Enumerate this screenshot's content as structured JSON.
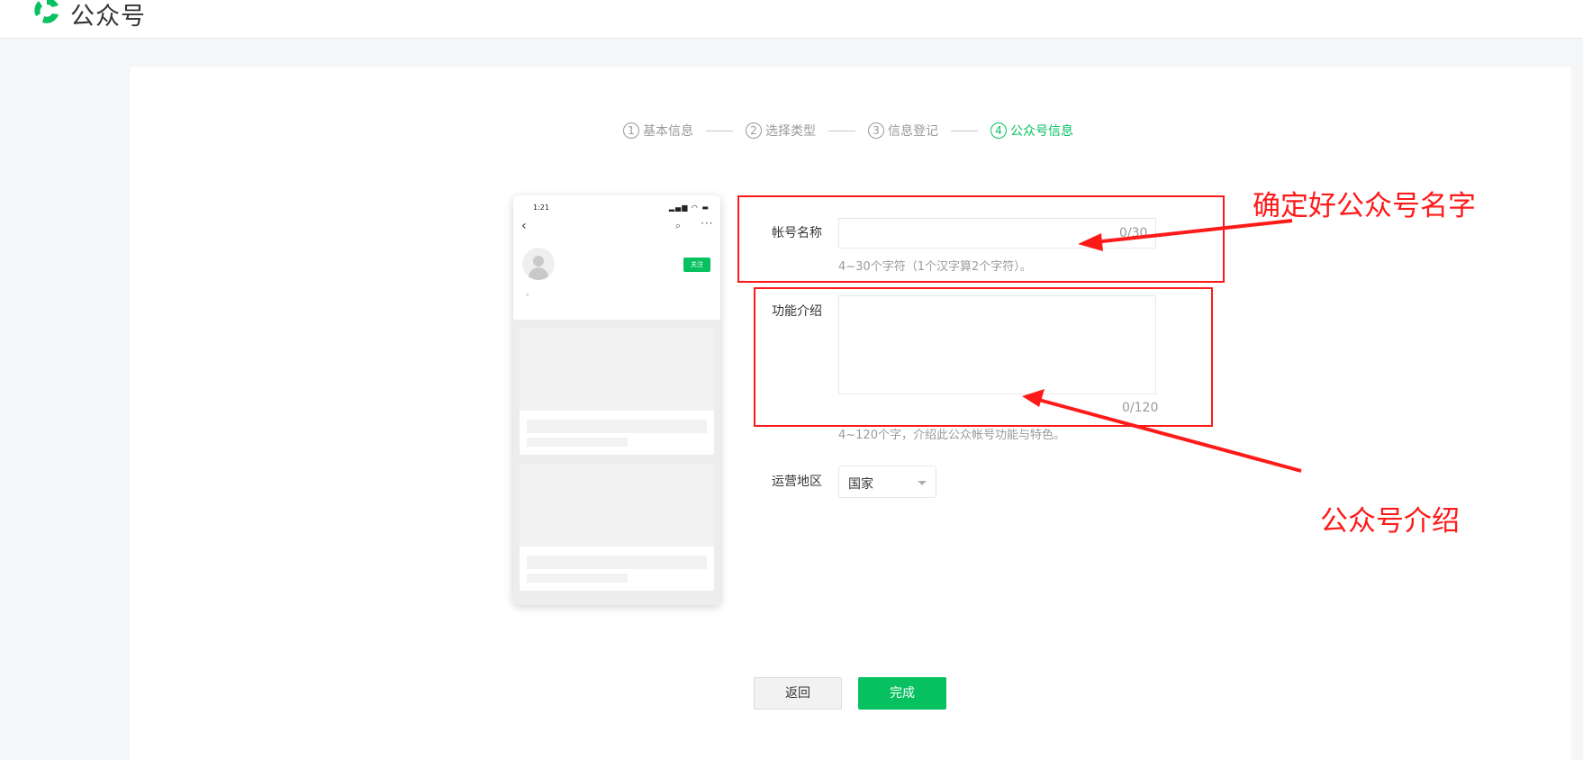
{
  "header": {
    "brand": "公众号",
    "logo_icon": "wechat-official-account-logo-icon"
  },
  "steps": [
    {
      "num": "1",
      "label": "基本信息",
      "active": false
    },
    {
      "num": "2",
      "label": "选择类型",
      "active": false
    },
    {
      "num": "3",
      "label": "信息登记",
      "active": false
    },
    {
      "num": "4",
      "label": "公众号信息",
      "active": true
    }
  ],
  "phone": {
    "time": "1:21",
    "follow_label": "关注"
  },
  "form": {
    "account_name": {
      "label": "帐号名称",
      "value": "",
      "counter": "0/30",
      "hint": "4~30个字符（1个汉字算2个字符）。"
    },
    "intro": {
      "label": "功能介绍",
      "value": "",
      "counter": "0/120",
      "hint": "4~120个字，介绍此公众帐号功能与特色。"
    },
    "region": {
      "label": "运营地区",
      "selected": "国家"
    }
  },
  "buttons": {
    "back": "返回",
    "done": "完成"
  },
  "annotations": {
    "name_note": "确定好公众号名字",
    "intro_note": "公众号介绍",
    "color": "#ff1a1a"
  },
  "colors": {
    "accent": "#07c160"
  }
}
